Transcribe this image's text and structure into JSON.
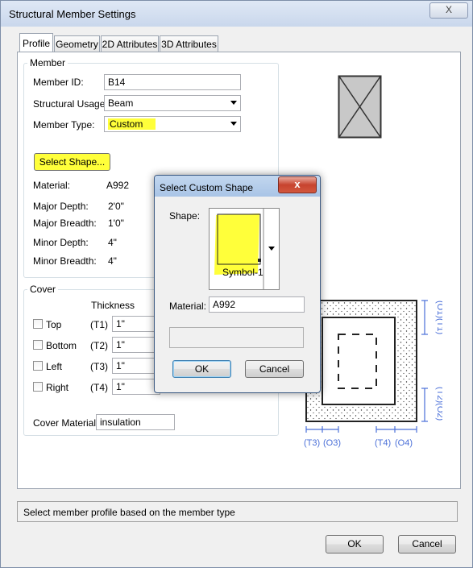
{
  "window": {
    "title": "Structural Member Settings",
    "close_glyph": "X"
  },
  "tabs": [
    "Profile",
    "Geometry",
    "2D Attributes",
    "3D Attributes"
  ],
  "member": {
    "legend": "Member",
    "id_label": "Member ID:",
    "id_value": "B14",
    "usage_label": "Structural Usage:",
    "usage_value": "Beam",
    "type_label": "Member Type:",
    "type_value": "Custom",
    "select_shape_button": "Select Shape...",
    "material_label": "Material:",
    "material_value": "A992",
    "major_depth_label": "Major Depth:",
    "major_depth_value": "2'0\"",
    "major_breadth_label": "Major Breadth:",
    "major_breadth_value": "1'0\"",
    "minor_depth_label": "Minor Depth:",
    "minor_depth_value": "4\"",
    "minor_breadth_label": "Minor Breadth:",
    "minor_breadth_value": "4\""
  },
  "cover": {
    "legend": "Cover",
    "thickness_header": "Thickness",
    "rows": [
      {
        "label": "Top",
        "code": "(T1)",
        "value": "1\""
      },
      {
        "label": "Bottom",
        "code": "(T2)",
        "value": "1\""
      },
      {
        "label": "Left",
        "code": "(T3)",
        "value": "1\""
      },
      {
        "label": "Right",
        "code": "(T4)",
        "value": "1\""
      }
    ],
    "material_label": "Cover Material:",
    "material_value": "insulation"
  },
  "diagram_labels": {
    "o1_t1": "(O1)(T1)",
    "t2_o2": "(T2)(O2)",
    "t3": "(T3)",
    "o3": "(O3)",
    "t4": "(T4)",
    "o4": "(O4)"
  },
  "dialog": {
    "title": "Select Custom Shape",
    "close_glyph": "x",
    "shape_label": "Shape:",
    "shape_name": "Symbol-1",
    "material_label": "Material:",
    "material_value": "A992",
    "ok": "OK",
    "cancel": "Cancel"
  },
  "status_text": "Select member profile based on the member type",
  "buttons": {
    "ok": "OK",
    "cancel": "Cancel"
  },
  "colors": {
    "highlight": "#ffff3a",
    "diagram_dim_blue": "#4a6fd8"
  }
}
